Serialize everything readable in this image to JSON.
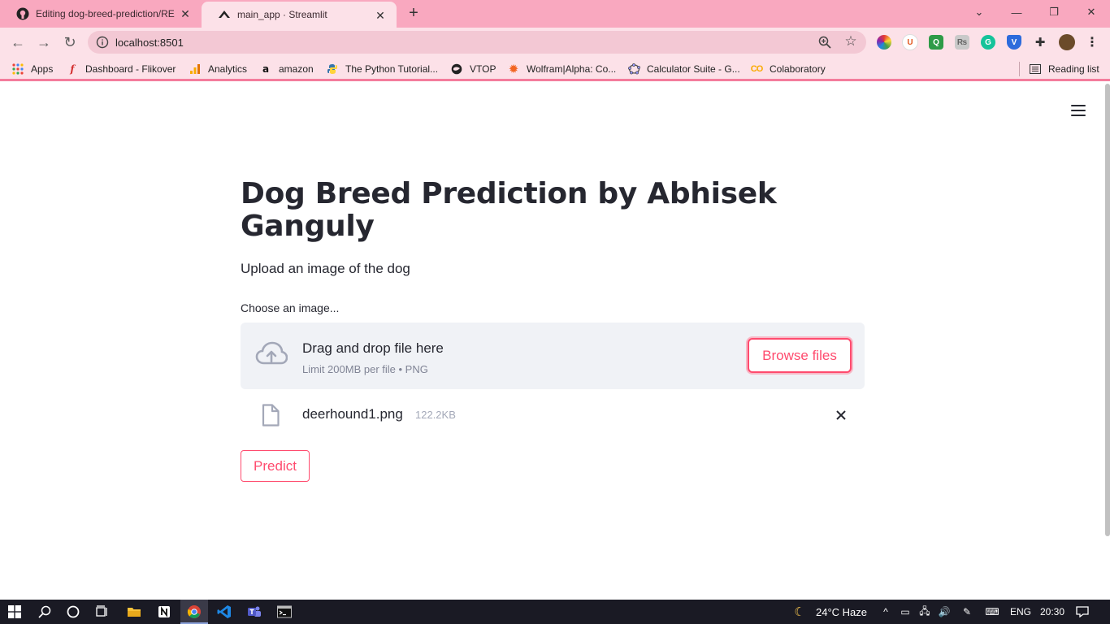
{
  "browser": {
    "tabs": [
      {
        "title": "Editing dog-breed-prediction/RE",
        "icon": "github-icon"
      },
      {
        "title": "main_app · Streamlit",
        "icon": "streamlit-icon"
      }
    ],
    "url": "localhost:8501",
    "bookmarks": [
      {
        "label": "Apps",
        "icon": "apps-grid-icon"
      },
      {
        "label": "Dashboard - Flikover",
        "icon": "flikover-icon"
      },
      {
        "label": "Analytics",
        "icon": "analytics-icon"
      },
      {
        "label": "amazon",
        "icon": "amazon-icon"
      },
      {
        "label": "The Python Tutorial...",
        "icon": "python-icon"
      },
      {
        "label": "VTOP",
        "icon": "vtop-icon"
      },
      {
        "label": "Wolfram|Alpha: Co...",
        "icon": "wolfram-icon"
      },
      {
        "label": "Calculator Suite - G...",
        "icon": "geogebra-icon"
      },
      {
        "label": "Colaboratory",
        "icon": "colab-icon"
      }
    ],
    "reading_list": "Reading list"
  },
  "app": {
    "title": "Dog Breed Prediction by Abhisek Ganguly",
    "subtitle": "Upload an image of the dog",
    "uploader": {
      "label": "Choose an image...",
      "drop_text": "Drag and drop file here",
      "limit_text": "Limit 200MB per file • PNG",
      "browse_label": "Browse files"
    },
    "uploaded_file": {
      "name": "deerhound1.png",
      "size": "122.2KB"
    },
    "predict_label": "Predict"
  },
  "taskbar": {
    "weather": "24°C  Haze",
    "language": "ENG",
    "time": "20:30"
  },
  "colors": {
    "accent": "#ff4b6e",
    "text": "#262730",
    "chrome_tab": "#f9a8bf"
  }
}
